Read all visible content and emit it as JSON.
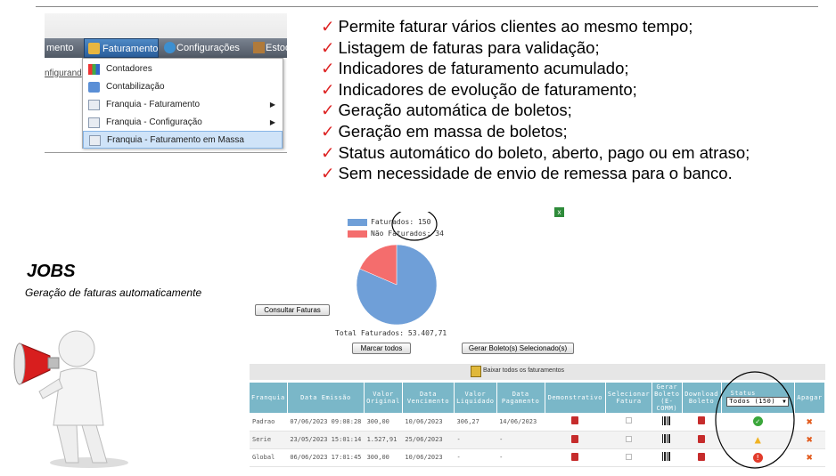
{
  "menu": {
    "bar_items": [
      "mento",
      "Faturamento",
      "Configurações",
      "Estoq"
    ],
    "sub_link": "nfigurand",
    "dropdown": [
      {
        "label": "Contadores",
        "icon": "chart-icon",
        "submenu": false
      },
      {
        "label": "Contabilização",
        "icon": "book-icon",
        "submenu": false
      },
      {
        "label": "Franquia - Faturamento",
        "icon": "page-icon",
        "submenu": true
      },
      {
        "label": "Franquia - Configuração",
        "icon": "page-icon",
        "submenu": true
      },
      {
        "label": "Franquia - Faturamento em Massa",
        "icon": "page-icon",
        "submenu": false,
        "selected": true
      }
    ]
  },
  "bullets": [
    "Permite faturar vários clientes ao mesmo tempo;",
    "Listagem de faturas para validação;",
    "Indicadores de faturamento acumulado;",
    "Indicadores de evolução de faturamento;",
    "Geração automática de boletos;",
    "Geração em massa de boletos;",
    "Status automático do boleto, aberto, pago ou em atraso;",
    "Sem necessidade de envio de remessa para o banco."
  ],
  "jobs": {
    "title": "JOBS",
    "subtitle": "Geração de faturas automaticamente"
  },
  "chart_data": {
    "type": "pie",
    "categories": [
      "Faturados",
      "Não Faturados"
    ],
    "values": [
      150,
      34
    ],
    "colors": [
      "#6f9fd8",
      "#f46d6d"
    ],
    "legend_labels": [
      "Faturados: 150",
      "Não Faturados: 34"
    ],
    "total_label": "Total Faturados: 53.407,71"
  },
  "buttons": {
    "consultar": "Consultar Faturas",
    "marcar": "Marcar todos",
    "gerar": "Gerar Boleto(s) Selecionado(s)",
    "baixar": "Baixar todos os faturamentos"
  },
  "table": {
    "headers": [
      "Franquia",
      "Data Emissão",
      "Valor Original",
      "Data Vencimento",
      "Valor Liquidado",
      "Data Pagamento",
      "Demonstrativo",
      "Selecionar Fatura",
      "Gerar Boleto (E-COMM)",
      "Download Boleto",
      "Status",
      "Apagar"
    ],
    "status_filter": "Todos (150)",
    "rows": [
      {
        "franquia": "Padrao",
        "emissao": "07/06/2023 09:08:28",
        "valor": "300,00",
        "vencimento": "10/06/2023",
        "liquidado": "306,27",
        "pagamento": "14/06/2023",
        "status": "paid"
      },
      {
        "franquia": "Serie",
        "emissao": "23/05/2023 15:01:14",
        "valor": "1.527,91",
        "vencimento": "25/06/2023",
        "liquidado": "-",
        "pagamento": "-",
        "status": "warning"
      },
      {
        "franquia": "Global",
        "emissao": "06/06/2023 17:01:45",
        "valor": "300,00",
        "vencimento": "10/06/2023",
        "liquidado": "-",
        "pagamento": "-",
        "status": "overdue"
      }
    ]
  },
  "colors": {
    "accent": "#d22222",
    "status_ok": "#3aa63a",
    "status_warn": "#f0b323",
    "status_bad": "#e23b2b",
    "header_bg": "#7ab7c8"
  }
}
